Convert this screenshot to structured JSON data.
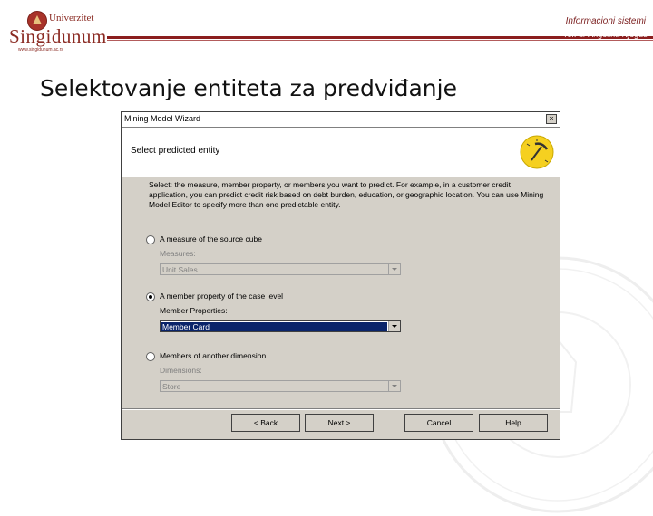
{
  "header": {
    "logo_top": "Univerzitet",
    "logo_main": "Singidunum",
    "logo_url": "www.singidunum.ac.rs",
    "course": "Informacioni sistemi",
    "professor": "Prof. dr Angelina Njeguš"
  },
  "slide": {
    "title": "Selektovanje entiteta za predviđanje"
  },
  "dialog": {
    "title": "Mining Model Wizard",
    "close_glyph": "×",
    "step_title": "Select predicted entity",
    "description": "Select: the measure, member property, or members you want to predict. For example, in a customer credit application, you can predict credit risk based on debt burden, education, or geographic location. You can use Mining Model Editor to specify more than one predictable entity.",
    "options": [
      {
        "label": "A measure of the source cube",
        "checked": false,
        "field_label": "Measures:",
        "value": "Unit Sales"
      },
      {
        "label": "A member property of the case level",
        "checked": true,
        "field_label": "Member Properties:",
        "value": "Member Card"
      },
      {
        "label": "Members of another dimension",
        "checked": false,
        "field_label": "Dimensions:",
        "value": "Store"
      }
    ],
    "buttons": {
      "back": "< Back",
      "next": "Next >",
      "cancel": "Cancel",
      "help": "Help"
    }
  }
}
